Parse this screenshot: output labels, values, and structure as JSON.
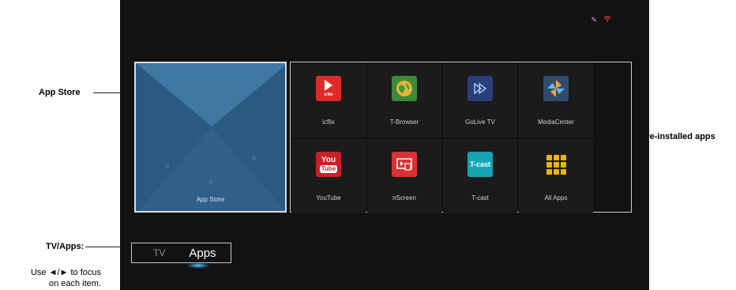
{
  "annotations": {
    "app_store": "App Store",
    "preinstalled": "Pre-installed apps",
    "tv_apps": "TV/Apps:",
    "help_line1": "Use ◄/► to focus",
    "help_line2": "on each item."
  },
  "status": {
    "pencil_icon": "pencil-icon",
    "wifi_icon": "wifi-icon"
  },
  "app_store_tile": {
    "label": "App Store"
  },
  "apps": [
    {
      "label": "icflix",
      "icon": "icflix-icon",
      "icon_text": "icflix"
    },
    {
      "label": "T-Browser",
      "icon": "globe-icon"
    },
    {
      "label": "GoLive TV",
      "icon": "play-forward-icon"
    },
    {
      "label": "MediaCenter",
      "icon": "media-center-icon"
    },
    {
      "label": "YouTube",
      "icon": "youtube-icon",
      "icon_text_top": "You",
      "icon_text_bottom": "Tube"
    },
    {
      "label": "nScreen",
      "icon": "nscreen-icon"
    },
    {
      "label": "T-cast",
      "icon": "tcast-icon",
      "icon_text": "T-cast"
    },
    {
      "label": "All Apps",
      "icon": "grid-icon"
    }
  ],
  "tabs": {
    "tv": "TV",
    "apps": "Apps"
  },
  "colors": {
    "screen_bg": "#121212",
    "tile_blue": "#2e6088",
    "focus_glow": "#5bc4ff"
  }
}
